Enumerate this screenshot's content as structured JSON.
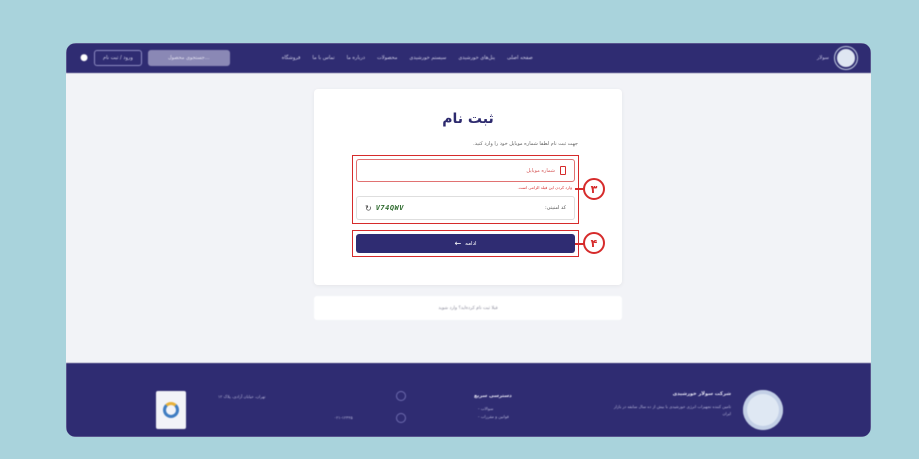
{
  "topbar": {
    "login_button": "ورود / ثبت نام",
    "search_placeholder": "جستجوی محصول...",
    "nav": [
      "صفحه اصلی",
      "پنل‌های خورشیدی",
      "سیستم خورشیدی",
      "محصولات",
      "درباره ما",
      "تماس با ما",
      "فروشگاه"
    ],
    "brand": "سولار"
  },
  "form": {
    "title": "ثبت نام",
    "subtitle": "جهت ثبت نام لطفا شماره موبایل خود را وارد کنید.",
    "phone_placeholder": "شماره موبایل",
    "phone_error": "وارد کردن این فیلد الزامی است.",
    "captcha_label": "کد امنیتی:",
    "captcha_code": "V74QWV",
    "continue_label": "ادامه",
    "marker_inputs": "۳",
    "marker_button": "۴",
    "login_prompt": "قبلا ثبت نام کرده‌اید؟ وارد شوید"
  },
  "footer": {
    "company": "شرکت سولار خورشیدی",
    "description": "تامین کننده تجهیزات انرژی خورشیدی با بیش از ده سال سابقه در بازار ایران",
    "support_title": "دسترسی سریع",
    "support_links": [
      "- سوالات",
      "- قوانین و مقررات"
    ],
    "address": "تهران، خیابان آزادی، پلاک ۱۲",
    "phone": "۰۲۱-۱۲۳۴۵"
  },
  "colors": {
    "primary": "#2f2c72",
    "accent_red": "#d62b2b",
    "background": "#a9d3dc"
  }
}
